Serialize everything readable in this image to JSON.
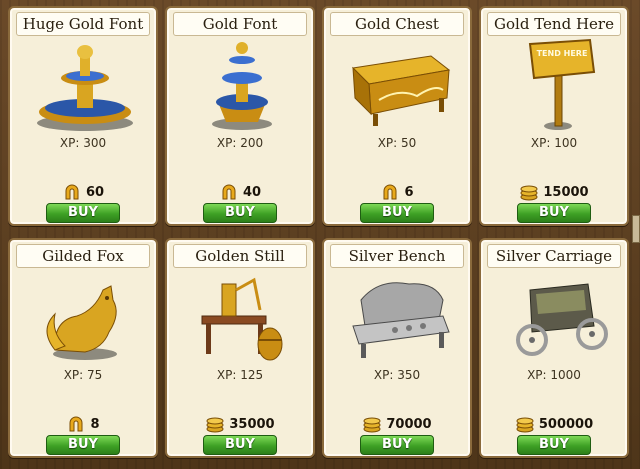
{
  "items": [
    {
      "title": "Huge Gold Font",
      "xp": "XP: 300",
      "price": "60",
      "currency": "horseshoe",
      "buy": "BUY"
    },
    {
      "title": "Gold Font",
      "xp": "XP: 200",
      "price": "40",
      "currency": "horseshoe",
      "buy": "BUY"
    },
    {
      "title": "Gold Chest",
      "xp": "XP: 50",
      "price": "6",
      "currency": "horseshoe",
      "buy": "BUY"
    },
    {
      "title": "Gold Tend Here",
      "xp": "XP: 100",
      "price": "15000",
      "currency": "coins",
      "buy": "BUY",
      "sign_text": "TEND HERE"
    },
    {
      "title": "Gilded Fox",
      "xp": "XP: 75",
      "price": "8",
      "currency": "horseshoe",
      "buy": "BUY"
    },
    {
      "title": "Golden Still",
      "xp": "XP: 125",
      "price": "35000",
      "currency": "coins",
      "buy": "BUY"
    },
    {
      "title": "Silver Bench",
      "xp": "XP: 350",
      "price": "70000",
      "currency": "coins",
      "buy": "BUY"
    },
    {
      "title": "Silver Carriage",
      "xp": "XP: 1000",
      "price": "500000",
      "currency": "coins",
      "buy": "BUY"
    }
  ],
  "colors": {
    "buy_green": "#3ea125",
    "card_bg": "#f6efd9",
    "gold": "#d9a521",
    "silver": "#9a9a9a"
  }
}
